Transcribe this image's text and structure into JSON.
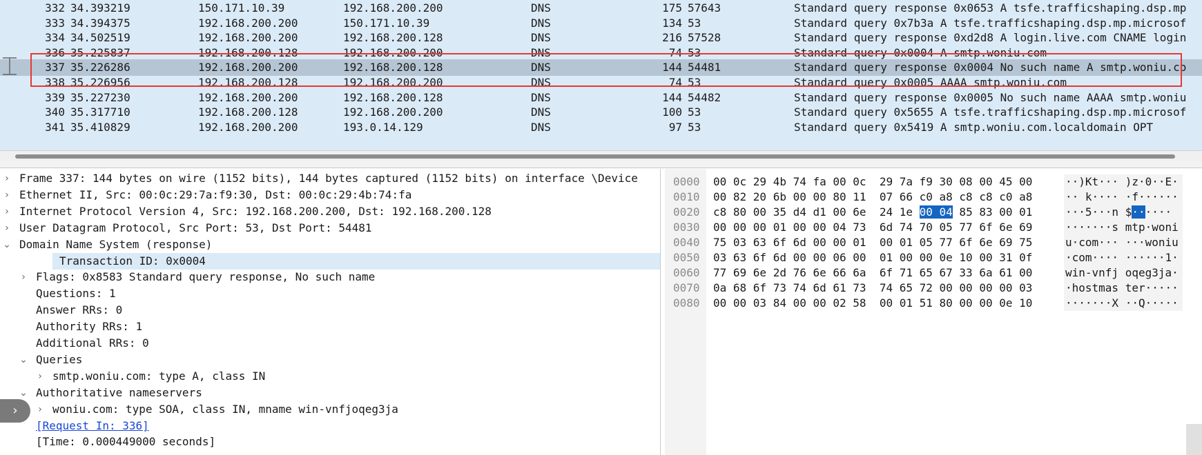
{
  "packet_list": {
    "rows": [
      {
        "no": "332",
        "time": "34.393219",
        "src": "150.171.10.39",
        "dst": "192.168.200.200",
        "proto": "DNS",
        "len": "175",
        "port": "57643",
        "info": "Standard query response 0x0653 A tsfe.trafficshaping.dsp.mp"
      },
      {
        "no": "333",
        "time": "34.394375",
        "src": "192.168.200.200",
        "dst": "150.171.10.39",
        "proto": "DNS",
        "len": "134",
        "port": "53",
        "info": "Standard query 0x7b3a A tsfe.trafficshaping.dsp.mp.microsof"
      },
      {
        "no": "334",
        "time": "34.502519",
        "src": "192.168.200.200",
        "dst": "192.168.200.128",
        "proto": "DNS",
        "len": "216",
        "port": "57528",
        "info": "Standard query response 0xd2d8 A login.live.com CNAME login"
      },
      {
        "no": "336",
        "time": "35.225837",
        "src": "192.168.200.128",
        "dst": "192.168.200.200",
        "proto": "DNS",
        "len": "74",
        "port": "53",
        "info": "Standard query 0x0004 A smtp.woniu.com"
      },
      {
        "no": "337",
        "time": "35.226286",
        "src": "192.168.200.200",
        "dst": "192.168.200.128",
        "proto": "DNS",
        "len": "144",
        "port": "54481",
        "info": "Standard query response 0x0004 No such name A smtp.woniu.co"
      },
      {
        "no": "338",
        "time": "35.226956",
        "src": "192.168.200.128",
        "dst": "192.168.200.200",
        "proto": "DNS",
        "len": "74",
        "port": "53",
        "info": "Standard query 0x0005 AAAA smtp.woniu.com"
      },
      {
        "no": "339",
        "time": "35.227230",
        "src": "192.168.200.200",
        "dst": "192.168.200.128",
        "proto": "DNS",
        "len": "144",
        "port": "54482",
        "info": "Standard query response 0x0005 No such name AAAA smtp.woniu"
      },
      {
        "no": "340",
        "time": "35.317710",
        "src": "192.168.200.128",
        "dst": "192.168.200.200",
        "proto": "DNS",
        "len": "100",
        "port": "53",
        "info": "Standard query 0x5655 A tsfe.trafficshaping.dsp.mp.microsof"
      },
      {
        "no": "341",
        "time": "35.410829",
        "src": "192.168.200.200",
        "dst": "193.0.14.129",
        "proto": "DNS",
        "len": "97",
        "port": "53",
        "info": "Standard query 0x5419 A smtp.woniu.com.localdomain OPT"
      }
    ],
    "selected_no": "337"
  },
  "detail_tree": [
    {
      "indent": 0,
      "twisty": "›",
      "text": "Frame 337: 144 bytes on wire (1152 bits), 144 bytes captured (1152 bits) on interface \\Device"
    },
    {
      "indent": 0,
      "twisty": "›",
      "text": "Ethernet II, Src: 00:0c:29:7a:f9:30, Dst: 00:0c:29:4b:74:fa"
    },
    {
      "indent": 0,
      "twisty": "›",
      "text": "Internet Protocol Version 4, Src: 192.168.200.200, Dst: 192.168.200.128"
    },
    {
      "indent": 0,
      "twisty": "›",
      "text": "User Datagram Protocol, Src Port: 53, Dst Port: 54481"
    },
    {
      "indent": 0,
      "twisty": "⌄",
      "text": "Domain Name System (response)"
    },
    {
      "indent": 1,
      "twisty": "",
      "text": "Transaction ID: 0x0004",
      "highlight": true
    },
    {
      "indent": 1,
      "twisty": "›",
      "text": "Flags: 0x8583 Standard query response, No such name"
    },
    {
      "indent": 1,
      "twisty": "",
      "text": "Questions: 1"
    },
    {
      "indent": 1,
      "twisty": "",
      "text": "Answer RRs: 0"
    },
    {
      "indent": 1,
      "twisty": "",
      "text": "Authority RRs: 1"
    },
    {
      "indent": 1,
      "twisty": "",
      "text": "Additional RRs: 0"
    },
    {
      "indent": 1,
      "twisty": "⌄",
      "text": "Queries"
    },
    {
      "indent": 2,
      "twisty": "›",
      "text": "smtp.woniu.com: type A, class IN"
    },
    {
      "indent": 1,
      "twisty": "⌄",
      "text": "Authoritative nameservers"
    },
    {
      "indent": 2,
      "twisty": "›",
      "text": "woniu.com: type SOA, class IN, mname win-vnfjoqeg3ja"
    },
    {
      "indent": 1,
      "twisty": "",
      "text": "[Request In: 336]",
      "link": true
    },
    {
      "indent": 1,
      "twisty": "",
      "text": "[Time: 0.000449000 seconds]"
    }
  ],
  "hex_dump": [
    {
      "offset": "0000",
      "hex": "00 0c 29 4b 74 fa 00 0c  29 7a f9 30 08 00 45 00",
      "ascii": "··)Kt··· )z·0··E·"
    },
    {
      "offset": "0010",
      "hex": "00 82 20 6b 00 00 80 11  07 66 c0 a8 c8 c8 c0 a8",
      "ascii": "·· k···· ·f······"
    },
    {
      "offset": "0020",
      "hex_pre": "c8 80 00 35 d4 d1 00 6e  24 1e ",
      "hex_sel": "00 04",
      "hex_post": " 85 83 00 01",
      "ascii_pre": "···5···n $",
      "ascii_sel": "··",
      "ascii_post": "····"
    },
    {
      "offset": "0030",
      "hex": "00 00 00 01 00 00 04 73  6d 74 70 05 77 6f 6e 69",
      "ascii": "·······s mtp·woni"
    },
    {
      "offset": "0040",
      "hex": "75 03 63 6f 6d 00 00 01  00 01 05 77 6f 6e 69 75",
      "ascii": "u·com··· ···woniu"
    },
    {
      "offset": "0050",
      "hex": "03 63 6f 6d 00 00 06 00  01 00 00 0e 10 00 31 0f",
      "ascii": "·com···· ······1·"
    },
    {
      "offset": "0060",
      "hex": "77 69 6e 2d 76 6e 66 6a  6f 71 65 67 33 6a 61 00",
      "ascii": "win-vnfj oqeg3ja·"
    },
    {
      "offset": "0070",
      "hex": "0a 68 6f 73 74 6d 61 73  74 65 72 00 00 00 00 03",
      "ascii": "·hostmas ter·····"
    },
    {
      "offset": "0080",
      "hex": "00 00 03 84 00 00 02 58  00 01 51 80 00 00 0e 10",
      "ascii": "·······X ··Q·····"
    }
  ],
  "side_button": {
    "icon": "chevron-right-icon",
    "glyph": "›"
  },
  "colors": {
    "list_bg": "#dbeaf7",
    "selected_row": "#b6c5d4",
    "highlight_box": "#e53935",
    "hex_selection": "#1565c0",
    "link": "#1a46d8"
  }
}
